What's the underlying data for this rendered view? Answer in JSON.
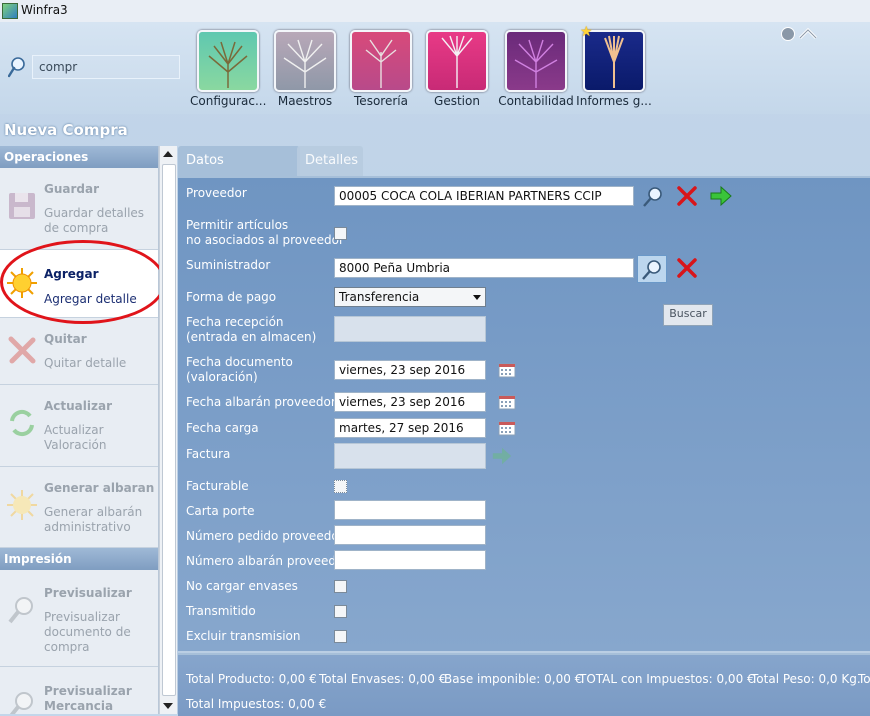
{
  "window": {
    "title": "Winfra3"
  },
  "search": {
    "value": "compr"
  },
  "modules": [
    {
      "label": "Configurac...",
      "color": "#5fc0a0",
      "icon": "tree-icon"
    },
    {
      "label": "Maestros",
      "color": "#a59aa8",
      "icon": "tree-icon"
    },
    {
      "label": "Tesorería",
      "color": "#d04a7a",
      "icon": "tree-icon"
    },
    {
      "label": "Gestion",
      "color": "#e0337f",
      "icon": "tree-icon"
    },
    {
      "label": "Contabilidad",
      "color": "#7a2b85",
      "icon": "tree-icon"
    },
    {
      "label": "Informes g...",
      "color": "#1a2f88",
      "icon": "tree-icon"
    }
  ],
  "page_title": "Nueva Compra",
  "sidebar": {
    "operaciones_header": "Operaciones",
    "actions": [
      {
        "title": "Guardar",
        "desc": "Guardar detalles de compra",
        "icon": "floppy-icon"
      },
      {
        "title": "Agregar",
        "desc": "Agregar detalle",
        "icon": "sun-icon"
      },
      {
        "title": "Quitar",
        "desc": "Quitar detalle",
        "icon": "x-icon"
      },
      {
        "title": "Actualizar",
        "desc": "Actualizar Valoración",
        "icon": "refresh-icon"
      },
      {
        "title": "Generar albaran",
        "desc": "Generar albarán administrativo",
        "icon": "sun-icon"
      }
    ],
    "impresion_header": "Impresión",
    "print_actions": [
      {
        "title": "Previsualizar",
        "desc": "Previsualizar documento de compra",
        "icon": "magnifier-icon"
      },
      {
        "title": "Previsualizar Mercancia",
        "desc": "",
        "icon": "magnifier-icon"
      }
    ]
  },
  "tabs": [
    "Datos generales",
    "Detalles"
  ],
  "form": {
    "proveedor_label": "Proveedor",
    "proveedor_value": "00005 COCA COLA IBERIAN PARTNERS CCIP",
    "permitir_label_1": "Permitir artículos",
    "permitir_label_2": "no asociados al proveedor",
    "suministrador_label": "Suministrador",
    "suministrador_value": "8000 Peña Umbria",
    "forma_pago_label": "Forma de pago",
    "forma_pago_value": "Transferencia",
    "fecha_recepcion_label_1": "Fecha recepción",
    "fecha_recepcion_label_2": "(entrada en almacen)",
    "fecha_documento_label_1": "Fecha documento",
    "fecha_documento_label_2": "(valoración)",
    "fecha_documento_value": "viernes, 23 sep 2016",
    "fecha_albaran_label": "Fecha albarán proveedor",
    "fecha_albaran_value": "viernes, 23 sep 2016",
    "fecha_carga_label": "Fecha carga",
    "fecha_carga_value": "martes, 27 sep 2016",
    "factura_label": "Factura",
    "facturable_label": "Facturable",
    "carta_porte_label": "Carta porte",
    "num_pedido_label": "Número pedido proveedor",
    "num_albaran_label": "Número albarán proveedor",
    "no_cargar_label": "No cargar envases",
    "transmitido_label": "Transmitido",
    "excluir_label": "Excluir transmision",
    "tooltip_buscar": "Buscar"
  },
  "totals": {
    "total_producto": "Total Producto:  0,00 €",
    "total_envases": "Total Envases:  0,00 €",
    "base_imponible": "Base imponible:  0,00 €",
    "total_con_impuestos": "TOTAL con Impuestos:  0,00 €",
    "total_peso": "Total Peso:  0,0 Kg.",
    "to": "To",
    "total_impuestos": "Total Impuestos:  0,00 €"
  }
}
